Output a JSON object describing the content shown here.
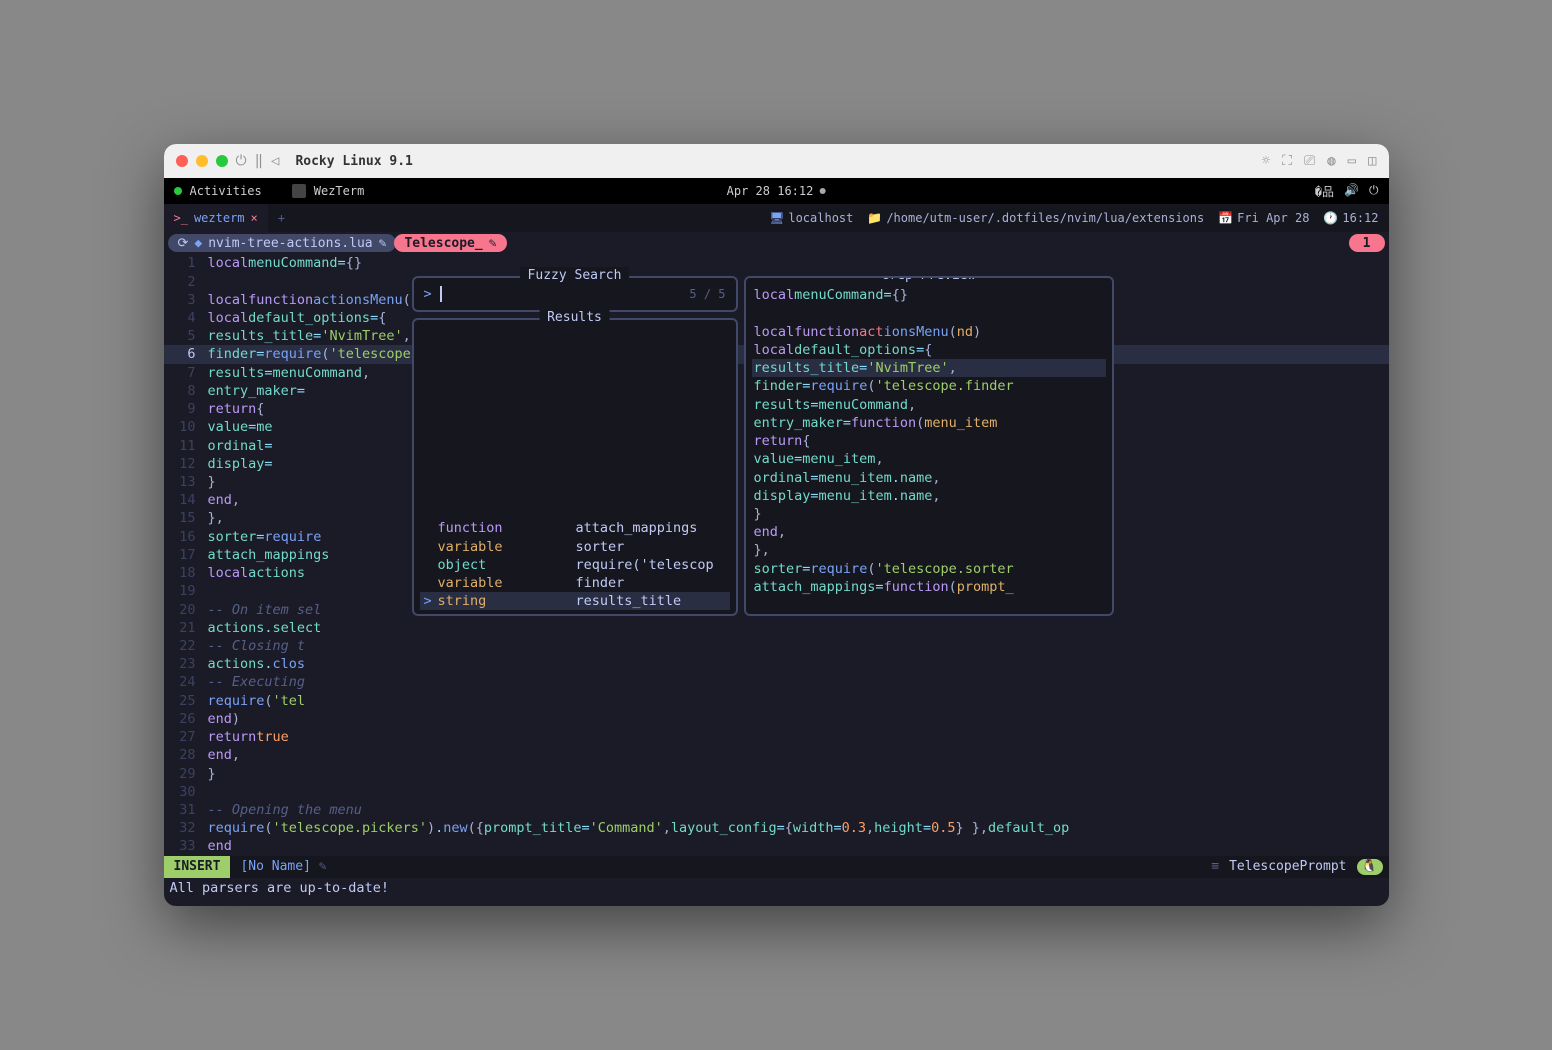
{
  "titlebar": {
    "os_label": "Rocky Linux 9.1"
  },
  "gnome": {
    "activities": "Activities",
    "app": "WezTerm",
    "datetime": "Apr 28  16:12"
  },
  "tabbar": {
    "tab1": "wezterm",
    "host": "localhost",
    "path": "/home/utm-user/.dotfiles/nvim/lua/extensions",
    "date": "Fri Apr 28",
    "time": "16:12"
  },
  "winbar": {
    "file_icon": "⟳",
    "file": "nvim-tree-actions.lua",
    "tele": "Telescope_",
    "num": "1"
  },
  "code": {
    "l1": "local menuCommand = {}",
    "l3": "local function actionsMenu(nd)",
    "l4": "  local default_options = {",
    "l5": "    results_title = 'NvimTree',",
    "l6": "    finder = require('telescope.finders').new_table {",
    "l7": "      results = menuCommand,",
    "l8": "      entry_maker =",
    "l9": "        return {",
    "l10": "          value = me",
    "l11": "          ordinal =",
    "l12": "          display =",
    "l13": "        }",
    "l14": "      end,",
    "l15": "    },",
    "l16": "    sorter = require",
    "l17": "    attach_mappings",
    "l18": "      local actions",
    "l20": "      -- On item sel",
    "l21": "      actions.select",
    "l22": "        -- Closing t",
    "l23": "        actions.clos",
    "l24": "        -- Executing",
    "l25": "        require('tel",
    "l26": "      end)",
    "l27": "      return true",
    "l28": "    end,",
    "l29": "  }",
    "l31": "  -- Opening the menu",
    "l32": "  require('telescope.pickers').new({ prompt_title = 'Command', layout_config = { width = 0.3, height = 0.5 } }, default_op",
    "l33": "end"
  },
  "telescope": {
    "search_title": "Fuzzy Search",
    "results_title": "Results",
    "preview_title": "Grep Preview",
    "prompt": ">",
    "count": "5 / 5",
    "results": [
      {
        "kind": "function",
        "name": "attach_mappings",
        "kstyle": "fn"
      },
      {
        "kind": "variable",
        "name": "sorter",
        "kstyle": ""
      },
      {
        "kind": "object",
        "name": "require('telescop",
        "kstyle": "obj"
      },
      {
        "kind": "variable",
        "name": "finder",
        "kstyle": ""
      },
      {
        "kind": "string",
        "name": "results_title",
        "kstyle": "",
        "selected": true
      }
    ]
  },
  "statusline": {
    "mode": "INSERT",
    "buffer": "[No Name]",
    "filetype": "TelescopePrompt"
  },
  "message": "All parsers are up-to-date!",
  "colors": {
    "bg": "#1a1b26",
    "fg": "#a9b1d6",
    "blue": "#7aa2f7",
    "green": "#9ece6a",
    "purple": "#bb9af7",
    "teal": "#73daca",
    "orange": "#ff9e64",
    "yellow": "#e0af68",
    "red": "#f7768e"
  }
}
